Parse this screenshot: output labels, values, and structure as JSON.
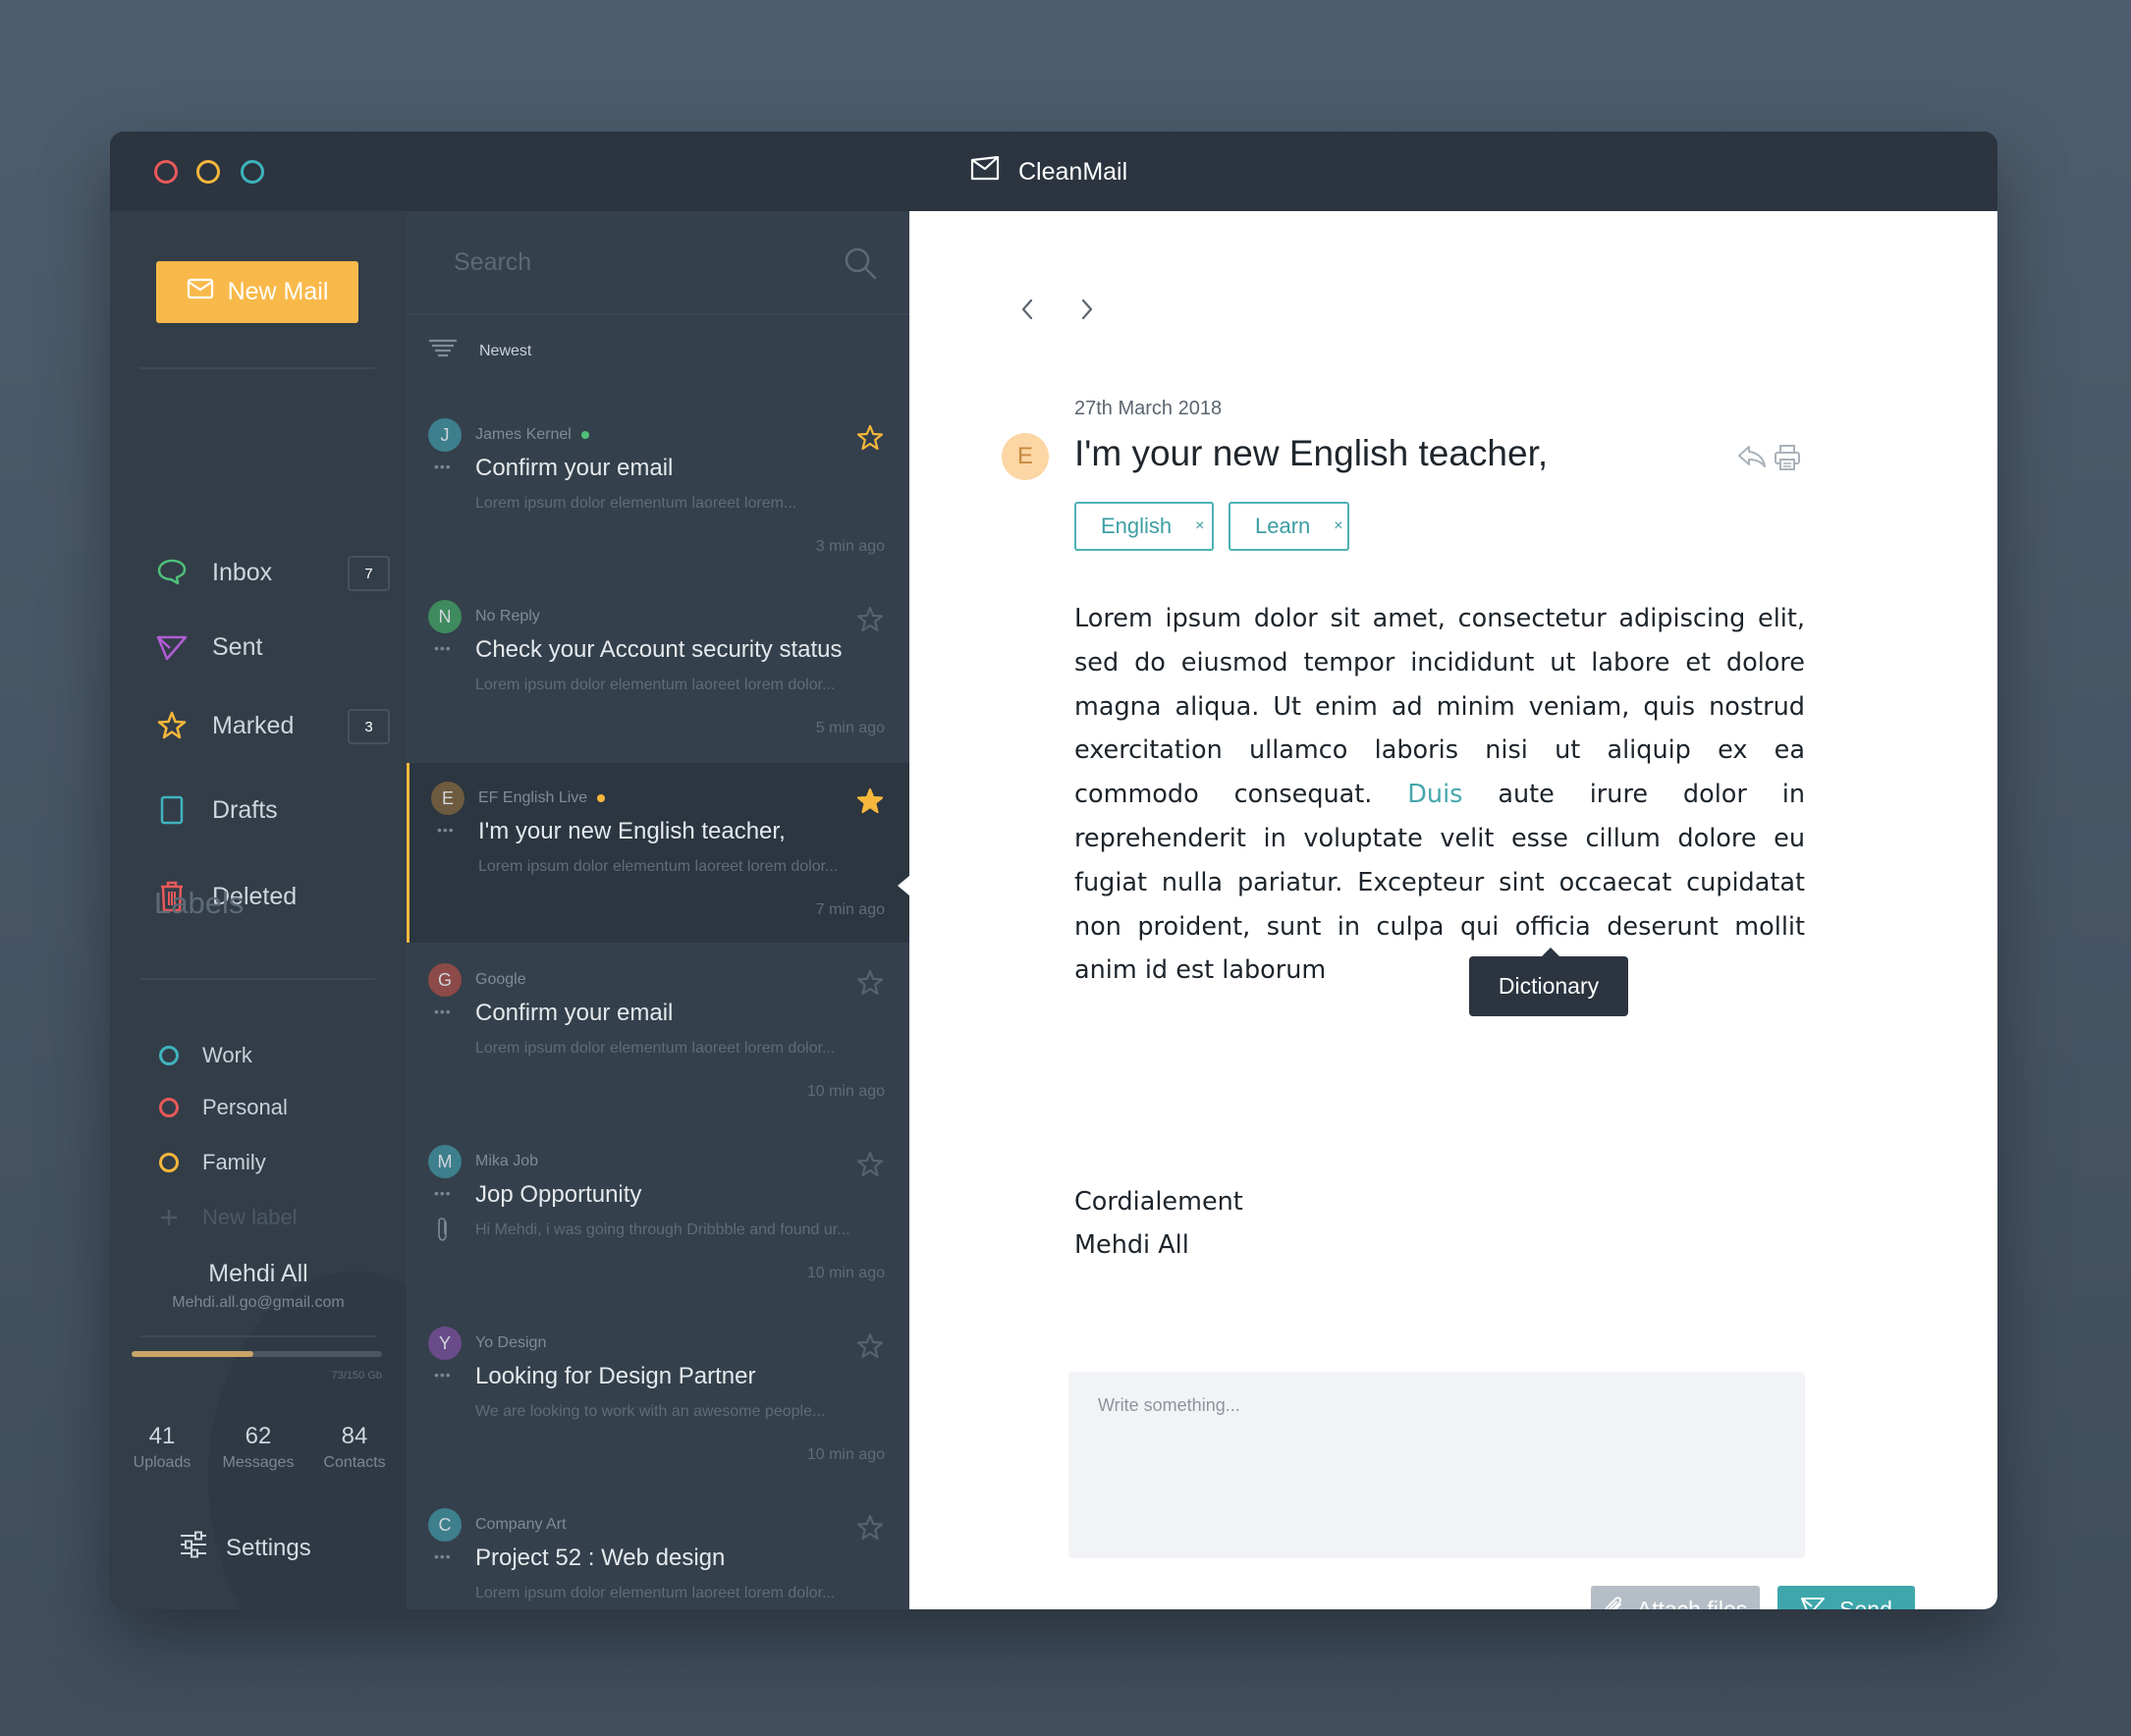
{
  "window": {
    "app_title": "CleanMail"
  },
  "sidebar": {
    "new_mail_label": "New Mail",
    "nav": [
      {
        "label": "Inbox",
        "badge": "7",
        "icon": "chat-bubble-icon",
        "color": "#4fbf7a"
      },
      {
        "label": "Sent",
        "badge": "",
        "icon": "send-triangle-icon",
        "color": "#b15cd6"
      },
      {
        "label": "Marked",
        "badge": "3",
        "icon": "star-outline-icon",
        "color": "#f6b73c"
      },
      {
        "label": "Drafts",
        "badge": "",
        "icon": "document-icon",
        "color": "#3fb3bd"
      },
      {
        "label": "Deleted",
        "badge": "",
        "icon": "trash-icon",
        "color": "#e8595a"
      }
    ],
    "labels_title": "Labels",
    "labels": [
      {
        "label": "Work",
        "color": "#3fb3bd"
      },
      {
        "label": "Personal",
        "color": "#e8595a"
      },
      {
        "label": "Family",
        "color": "#f6b73c"
      }
    ],
    "new_label": "New label",
    "user": {
      "name": "Mehdi All",
      "email": "Mehdi.all.go@gmail.com",
      "storage_text": "73/150 Gb",
      "storage_fraction": 0.4867
    },
    "stats": [
      {
        "value": "41",
        "caption": "Uploads"
      },
      {
        "value": "62",
        "caption": "Messages"
      },
      {
        "value": "84",
        "caption": "Contacts"
      }
    ],
    "settings_label": "Settings"
  },
  "list": {
    "search_placeholder": "Search",
    "sort_label": "Newest",
    "mails": [
      {
        "initial": "J",
        "avatar_color": "#3d7f8c",
        "sender": "James Kernel",
        "online_color": "#4fbf7a",
        "subject": "Confirm your email",
        "preview": "Lorem ipsum dolor elementum laoreet lorem...",
        "time": "3 min ago",
        "starred": true,
        "star_style": "outline-yellow",
        "attachment": false,
        "active": false
      },
      {
        "initial": "N",
        "avatar_color": "#3f8a5e",
        "sender": "No Reply",
        "online_color": "",
        "subject": "Check your Account security status",
        "preview": "Lorem ipsum dolor elementum laoreet lorem dolor...",
        "time": "5 min ago",
        "starred": false,
        "star_style": "outline-grey",
        "attachment": false,
        "active": false
      },
      {
        "initial": "E",
        "avatar_color": "#6e5a3e",
        "sender": "EF English Live",
        "online_color": "#f6b73c",
        "subject": "I'm your new English teacher,",
        "preview": "Lorem ipsum dolor elementum laoreet lorem dolor...",
        "time": "7 min ago",
        "starred": true,
        "star_style": "filled-yellow",
        "attachment": false,
        "active": true
      },
      {
        "initial": "G",
        "avatar_color": "#8c4a48",
        "sender": "Google",
        "online_color": "",
        "subject": "Confirm your email",
        "preview": "Lorem ipsum dolor elementum laoreet lorem dolor...",
        "time": "10 min ago",
        "starred": false,
        "star_style": "outline-grey",
        "attachment": false,
        "active": false
      },
      {
        "initial": "M",
        "avatar_color": "#3d7f8c",
        "sender": "Mika Job",
        "online_color": "",
        "subject": "Jop Opportunity",
        "preview": "Hi Mehdi, i was going through Dribbble and found ur...",
        "time": "10 min ago",
        "starred": false,
        "star_style": "outline-grey",
        "attachment": true,
        "active": false
      },
      {
        "initial": "Y",
        "avatar_color": "#6a4b8a",
        "sender": "Yo Design",
        "online_color": "",
        "subject": "Looking for Design Partner",
        "preview": "We are looking to work with an awesome people...",
        "time": "10 min ago",
        "starred": false,
        "star_style": "outline-grey",
        "attachment": false,
        "active": false
      },
      {
        "initial": "C",
        "avatar_color": "#3d7f8c",
        "sender": "Company Art",
        "online_color": "",
        "subject": "Project 52 : Web design",
        "preview": "Lorem ipsum dolor elementum laoreet lorem dolor...",
        "time": "",
        "starred": false,
        "star_style": "outline-grey",
        "attachment": false,
        "active": false
      }
    ]
  },
  "reader": {
    "date": "27th March 2018",
    "sender_initial": "E",
    "title": "I'm your new English teacher,",
    "tags": [
      {
        "label": "English",
        "remove": "×"
      },
      {
        "label": "Learn",
        "remove": "×"
      }
    ],
    "body_before_link": "Lorem ipsum dolor sit amet, consectetur adipiscing elit, sed do eiusmod tempor incididunt ut labore et dolore magna aliqua. Ut enim ad minim veniam, quis nostrud exercitation ullamco laboris nisi ut aliquip ex ea commodo consequat.",
    "link_word": "Duis",
    "body_after_link": "aute irure dolor in reprehenderit in voluptate velit esse cillum dolore eu fugiat nulla pariatur. Excepteur sint occaecat cupidatat non proident, sunt in culpa qui officia deserunt mollit anim id est laborum",
    "tooltip": "Dictionary",
    "signoff": "Cordialement",
    "signature": "Mehdi All",
    "composer_placeholder": "Write something...",
    "attach_label": "Attach files",
    "send_label": "Send"
  }
}
